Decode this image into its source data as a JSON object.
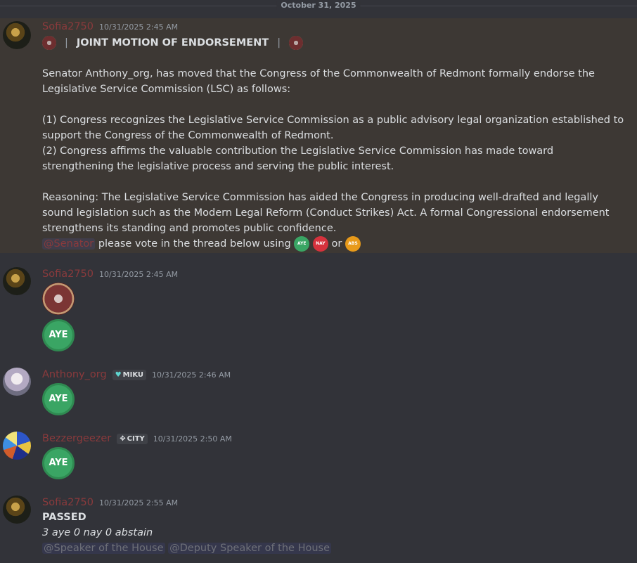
{
  "date_divider": "October 31, 2025",
  "messages": [
    {
      "username": "Sofia2750",
      "timestamp": "10/31/2025 2:45 AM",
      "title": "JOINT MOTION OF ENDORSEMENT",
      "separator": "|",
      "intro": " Senator Anthony_org, has moved that the Congress of the Commonwealth of Redmont formally endorse the Legislative Service Commission (LSC) as follows:",
      "point1": " (1) Congress recognizes the Legislative Service Commission as a public advisory legal organization established to support the Congress of the Commonwealth of Redmont.",
      "point2": "(2) Congress affirms the valuable contribution the Legislative Service Commission has made toward strengthening the legislative process and serving the public interest.",
      "reasoning": "Reasoning: The Legislative Service Commission has aided the Congress in producing well-drafted and legally sound legislation such as the Modern Legal Reform (Conduct Strikes) Act. A formal Congressional endorsement strengthens its standing and promotes public confidence.",
      "mention": "@Senator",
      "vote_text": " please vote in the thread below using ",
      "or_text": " or ",
      "aye_label": "AYE",
      "nay_label": "NAY",
      "abs_label": "ABS"
    },
    {
      "username": "Sofia2750",
      "timestamp": "10/31/2025 2:45 AM",
      "aye_label": "AYE"
    },
    {
      "username": "Anthony_org",
      "tag": "MIKU",
      "timestamp": "10/31/2025 2:46 AM",
      "aye_label": "AYE"
    },
    {
      "username": "Bezzergeezer",
      "tag": "CITY",
      "timestamp": "10/31/2025 2:50 AM",
      "aye_label": "AYE"
    },
    {
      "username": "Sofia2750",
      "timestamp": "10/31/2025 2:55 AM",
      "result": "PASSED",
      "tally": "3 aye 0 nay 0 abstain",
      "mention1": "@Speaker of the House",
      "mention2": "@Deputy Speaker of the House"
    }
  ],
  "colors": {
    "background": "#323339",
    "highlight": "#3d3834",
    "username": "#8a3a3c",
    "aye": "#3aa564",
    "nay": "#d6323d",
    "abs": "#e89a1a"
  }
}
